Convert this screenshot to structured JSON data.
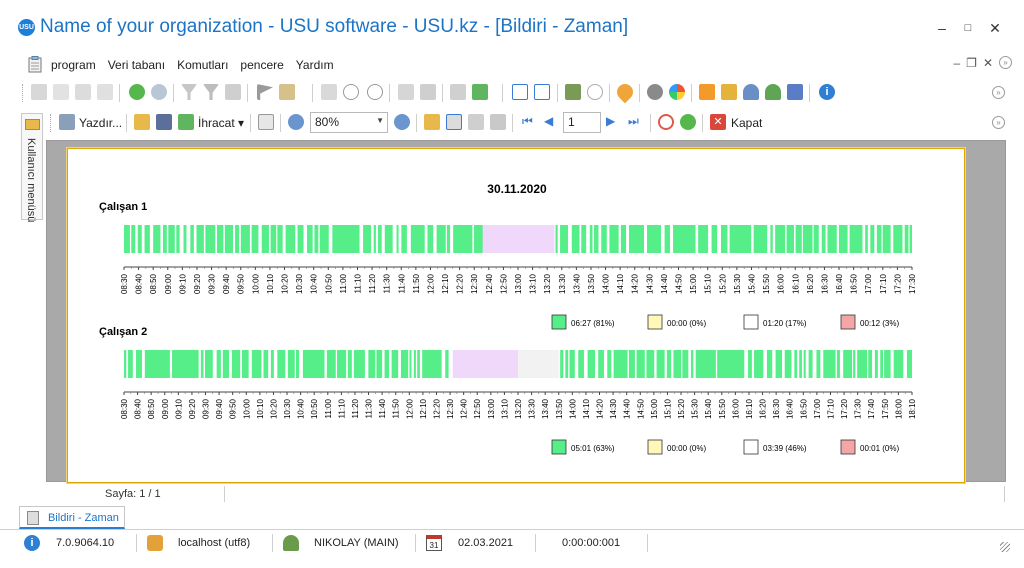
{
  "window": {
    "title": "Name of your organization - USU software - USU.kz - [Bildiri - Zaman]",
    "logo_text": "USU"
  },
  "menu": {
    "items": [
      "program",
      "Veri tabanı",
      "Komutları",
      "pencere",
      "Yardım"
    ]
  },
  "toolbar": {
    "print_label": "Yazdır...",
    "export_label": "İhracat",
    "zoom_value": "80%",
    "page_value": "1",
    "close_label": "Kapat"
  },
  "side_tab": {
    "label": "Kullanıcı menüsü"
  },
  "report": {
    "date": "30.11.2020",
    "rows": [
      {
        "employee": "Çalışan 1",
        "ticks": [
          "08:30",
          "08:40",
          "08:50",
          "09:00",
          "09:10",
          "09:20",
          "09:30",
          "09:40",
          "09:50",
          "10:00",
          "10:10",
          "10:20",
          "10:30",
          "10:40",
          "10:50",
          "11:00",
          "11:10",
          "11:20",
          "11:30",
          "11:40",
          "11:50",
          "12:00",
          "12:10",
          "12:20",
          "12:30",
          "12:40",
          "12:50",
          "13:00",
          "13:10",
          "13:20",
          "13:30",
          "13:40",
          "13:50",
          "14:00",
          "14:10",
          "14:20",
          "14:30",
          "14:40",
          "14:50",
          "15:00",
          "15:10",
          "15:20",
          "15:30",
          "15:40",
          "15:50",
          "16:00",
          "16:10",
          "16:20",
          "16:30",
          "16:40",
          "16:50",
          "17:00",
          "17:10",
          "17:20",
          "17:30"
        ],
        "legend": [
          {
            "color": "#55ee88",
            "text": "06:27 (81%)"
          },
          {
            "color": "#fff8b8",
            "text": "00:00 (0%)"
          },
          {
            "color": "#ffffff",
            "text": "01:20 (17%)"
          },
          {
            "color": "#f4a6a6",
            "text": "00:12 (3%)"
          }
        ]
      },
      {
        "employee": "Çalışan 2",
        "ticks": [
          "08:30",
          "08:40",
          "08:50",
          "09:00",
          "09:10",
          "09:20",
          "09:30",
          "09:40",
          "09:50",
          "10:00",
          "10:10",
          "10:20",
          "10:30",
          "10:40",
          "10:50",
          "11:00",
          "11:10",
          "11:20",
          "11:30",
          "11:40",
          "11:50",
          "12:00",
          "12:10",
          "12:20",
          "12:30",
          "12:40",
          "12:50",
          "13:00",
          "13:10",
          "13:20",
          "13:30",
          "13:40",
          "13:50",
          "14:00",
          "14:10",
          "14:20",
          "14:30",
          "14:40",
          "14:50",
          "15:00",
          "15:10",
          "15:20",
          "15:30",
          "15:40",
          "15:50",
          "16:00",
          "16:10",
          "16:20",
          "16:30",
          "16:40",
          "16:50",
          "17:00",
          "17:10",
          "17:20",
          "17:30",
          "17:40",
          "17:50",
          "18:00",
          "18:10"
        ],
        "legend": [
          {
            "color": "#55ee88",
            "text": "05:01 (63%)"
          },
          {
            "color": "#fff8b8",
            "text": "00:00 (0%)"
          },
          {
            "color": "#ffffff",
            "text": "03:39 (46%)"
          },
          {
            "color": "#f4a6a6",
            "text": "00:01 (0%)"
          }
        ]
      }
    ],
    "colors": {
      "active": "#55ee88",
      "idle": "#f0d8fb",
      "offline": "#f2f2f2"
    }
  },
  "page_status": "Sayfa: 1 / 1",
  "doc_tab": {
    "label": "Bildiri - Zaman"
  },
  "statusbar": {
    "version": "7.0.9064.10",
    "database": "localhost (utf8)",
    "user": "NIKOLAY (MAIN)",
    "date": "02.03.2021",
    "timer": "0:00:00:001",
    "calendar_day": "31"
  }
}
